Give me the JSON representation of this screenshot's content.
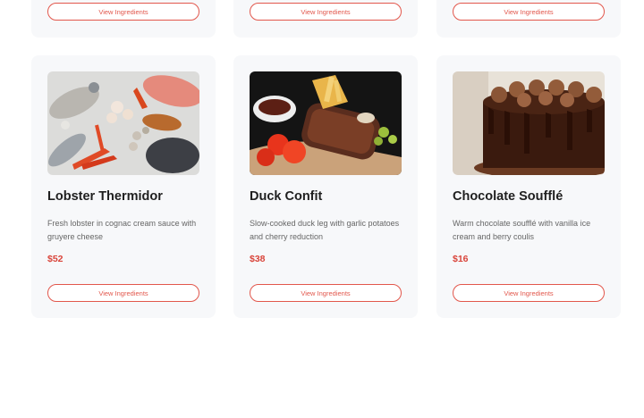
{
  "top_row": [
    {
      "button_label": "View Ingredients"
    },
    {
      "button_label": "View Ingredients"
    },
    {
      "button_label": "View Ingredients"
    }
  ],
  "dishes": [
    {
      "title": "Lobster Thermidor",
      "description": "Fresh lobster in cognac cream sauce with gruyere cheese",
      "price": "$52",
      "button_label": "View Ingredients"
    },
    {
      "title": "Duck Confit",
      "description": "Slow-cooked duck leg with garlic potatoes and cherry reduction",
      "price": "$38",
      "button_label": "View Ingredients"
    },
    {
      "title": "Chocolate Soufflé",
      "description": "Warm chocolate soufflé with vanilla ice cream and berry coulis",
      "price": "$16",
      "button_label": "View Ingredients"
    }
  ],
  "colors": {
    "accent": "#e2574c",
    "price": "#d9443a",
    "card_bg": "#f7f8fa"
  }
}
